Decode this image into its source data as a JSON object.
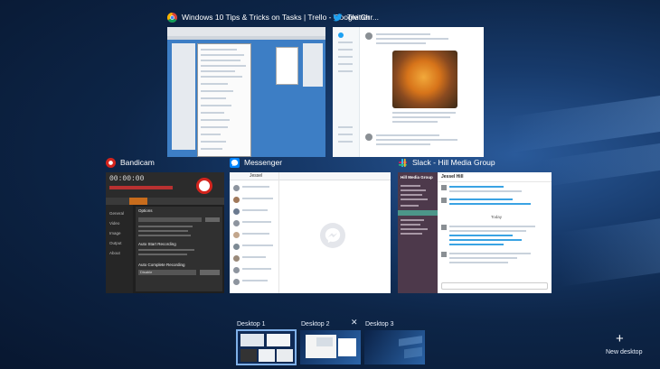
{
  "windows": {
    "chrome": {
      "title": "Windows 10 Tips & Tricks on Tasks | Trello - Google Chr..."
    },
    "twitter": {
      "title": "Twitter"
    },
    "bandicam": {
      "title": "Bandicam",
      "timer": "00:00:00",
      "nav": [
        "General",
        "Video",
        "Image",
        "Output",
        "About"
      ],
      "section_options": "Options",
      "section_auto_start": "Auto Start Recording",
      "section_auto_complete": "Auto Complete Recording",
      "select_value": "Disable"
    },
    "messenger": {
      "title": "Messenger",
      "header": "Jessel"
    },
    "slack": {
      "title": "Slack - Hill Media Group",
      "team_name": "Hill Media Group",
      "channel_header": "Jessel Hill",
      "date_divider": "Today"
    }
  },
  "desktops": {
    "items": [
      {
        "label": "Desktop 1"
      },
      {
        "label": "Desktop 2"
      },
      {
        "label": "Desktop 3"
      }
    ],
    "close_glyph": "✕",
    "new_desktop_glyph": "+",
    "new_desktop_label": "New desktop"
  }
}
